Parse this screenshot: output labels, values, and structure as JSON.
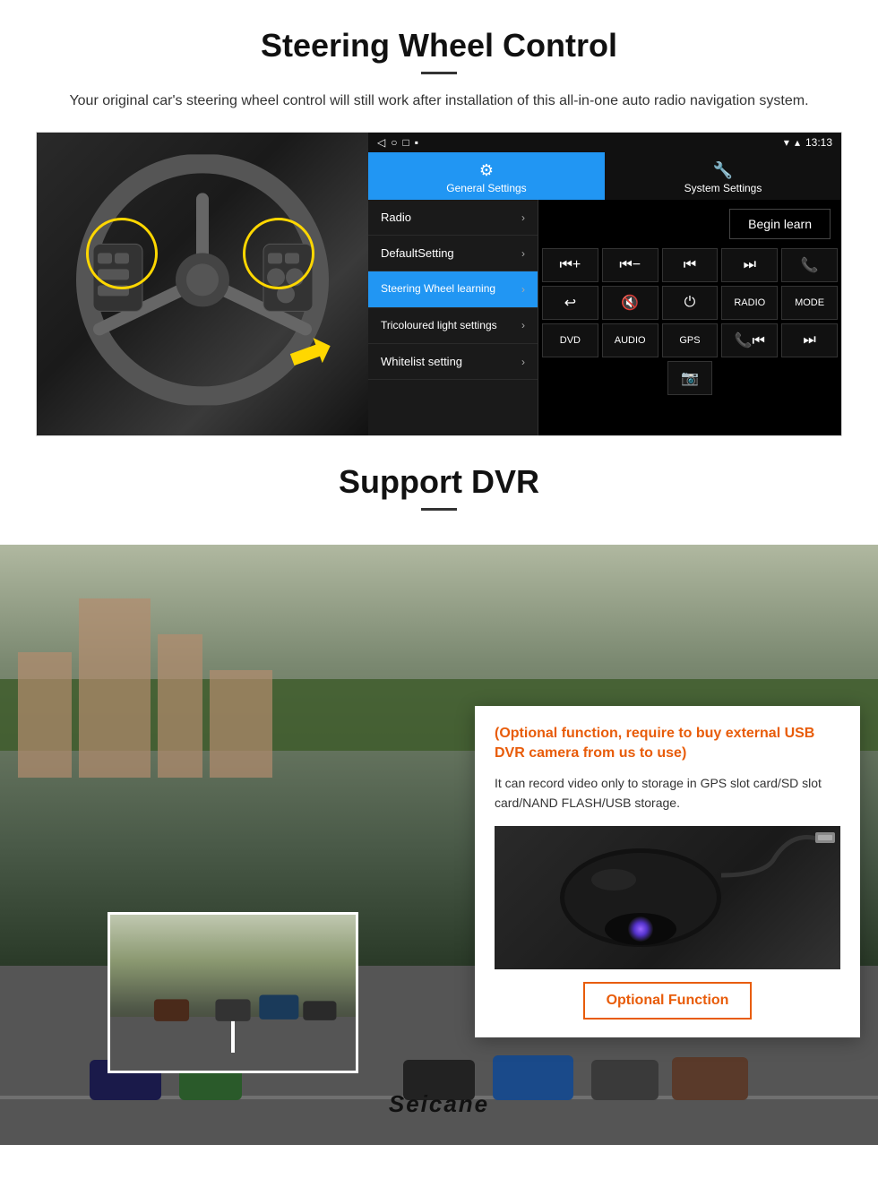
{
  "steering_section": {
    "title": "Steering Wheel Control",
    "subtitle": "Your original car's steering wheel control will still work after installation of this all-in-one auto radio navigation system.",
    "statusbar": {
      "time": "13:13",
      "signal_icon": "▼",
      "wifi_icon": "▲"
    },
    "tabs": {
      "general_settings": {
        "label": "General Settings",
        "icon": "⚙"
      },
      "system_settings": {
        "label": "System Settings",
        "icon": "🔧"
      }
    },
    "menu_items": [
      {
        "label": "Radio",
        "active": false
      },
      {
        "label": "DefaultSetting",
        "active": false
      },
      {
        "label": "Steering Wheel learning",
        "active": true
      },
      {
        "label": "Tricoloured light settings",
        "active": false
      },
      {
        "label": "Whitelist setting",
        "active": false
      }
    ],
    "begin_learn_label": "Begin learn",
    "control_buttons": {
      "row1": [
        "⏮+",
        "⏮-",
        "⏮",
        "⏭",
        "📞"
      ],
      "row2": [
        "↩",
        "🔇",
        "⏻",
        "RADIO",
        "MODE"
      ],
      "row3": [
        "DVD",
        "AUDIO",
        "GPS",
        "📞⏮",
        "⏭"
      ]
    }
  },
  "dvr_section": {
    "title": "Support DVR",
    "optional_text": "(Optional function, require to buy external USB DVR camera from us to use)",
    "description": "It can record video only to storage in GPS slot card/SD slot card/NAND FLASH/USB storage.",
    "optional_function_label": "Optional Function"
  },
  "branding": {
    "name": "Seicane"
  }
}
